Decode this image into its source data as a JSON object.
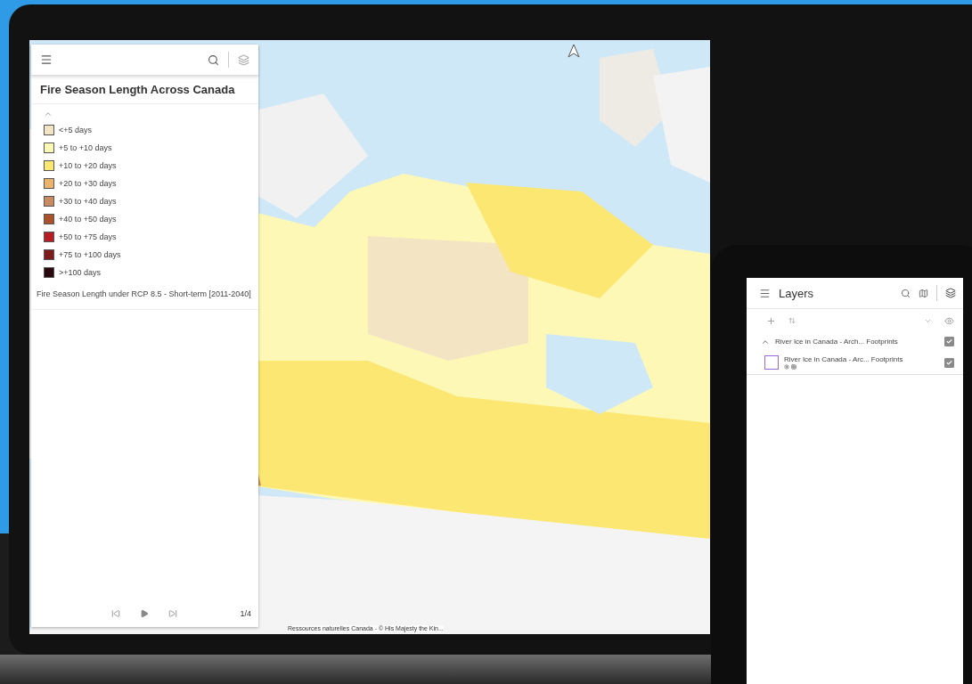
{
  "laptop": {
    "panel": {
      "title": "Fire Season Length Across Canada",
      "legend_expanded": true,
      "legend": [
        {
          "label": "<+5 days",
          "color": "#f3e4c4"
        },
        {
          "label": "+5 to +10 days",
          "color": "#fdf8b6"
        },
        {
          "label": "+10 to +20 days",
          "color": "#fbe772"
        },
        {
          "label": "+20 to +30 days",
          "color": "#ebb46e"
        },
        {
          "label": "+30 to +40 days",
          "color": "#c98c62"
        },
        {
          "label": "+40 to +50 days",
          "color": "#a9522c"
        },
        {
          "label": "+50 to +75 days",
          "color": "#b51e22"
        },
        {
          "label": "+75 to +100 days",
          "color": "#7e1b1d"
        },
        {
          "label": ">+100 days",
          "color": "#2a0810"
        }
      ],
      "layer_name": "Fire Season Length under RCP 8.5 - Short-term [2011-2040]",
      "page": "1/4"
    },
    "attribution": "Ressources naturelles Canada - © His Majesty the Kin..."
  },
  "tablet": {
    "title": "Layers",
    "groups": [
      {
        "name": "River Ice in Canada - Arch... Footprints",
        "expanded": true,
        "checked": true,
        "children": [
          {
            "name": "River Ice in Canada - Arc... Footprints",
            "checked": true
          }
        ]
      }
    ]
  }
}
